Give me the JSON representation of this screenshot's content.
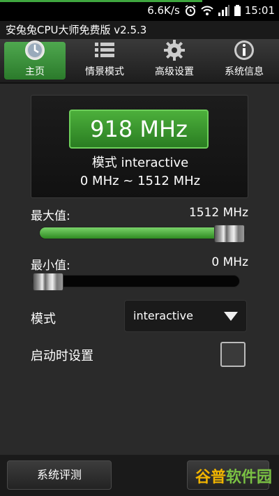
{
  "statusbar": {
    "speed": "6.6K/s",
    "time": "15:01"
  },
  "app": {
    "title": "安兔兔CPU大师免费版 v2.5.3"
  },
  "tabs": [
    {
      "label": "主页",
      "icon": "clock-icon",
      "active": true
    },
    {
      "label": "情景模式",
      "icon": "list-icon",
      "active": false
    },
    {
      "label": "高级设置",
      "icon": "gear-icon",
      "active": false
    },
    {
      "label": "系统信息",
      "icon": "info-icon",
      "active": false
    }
  ],
  "status": {
    "current_freq": "918 MHz",
    "mode_text": "模式 interactive",
    "range_text": "0 MHz ~ 1512 MHz"
  },
  "max_slider": {
    "label": "最大值:",
    "value": "1512 MHz",
    "fraction": 1.0
  },
  "min_slider": {
    "label": "最小值:",
    "value": "0 MHz",
    "fraction": 0.0
  },
  "governor": {
    "label": "模式",
    "selected": "interactive"
  },
  "boot": {
    "label": "启动时设置",
    "checked": false
  },
  "bottom": {
    "benchmark_label": "系统评测"
  },
  "watermark": {
    "part1": "谷普",
    "part2": "软件园"
  },
  "colors": {
    "accent": "#3fa63f",
    "background": "#2a2a2a"
  }
}
